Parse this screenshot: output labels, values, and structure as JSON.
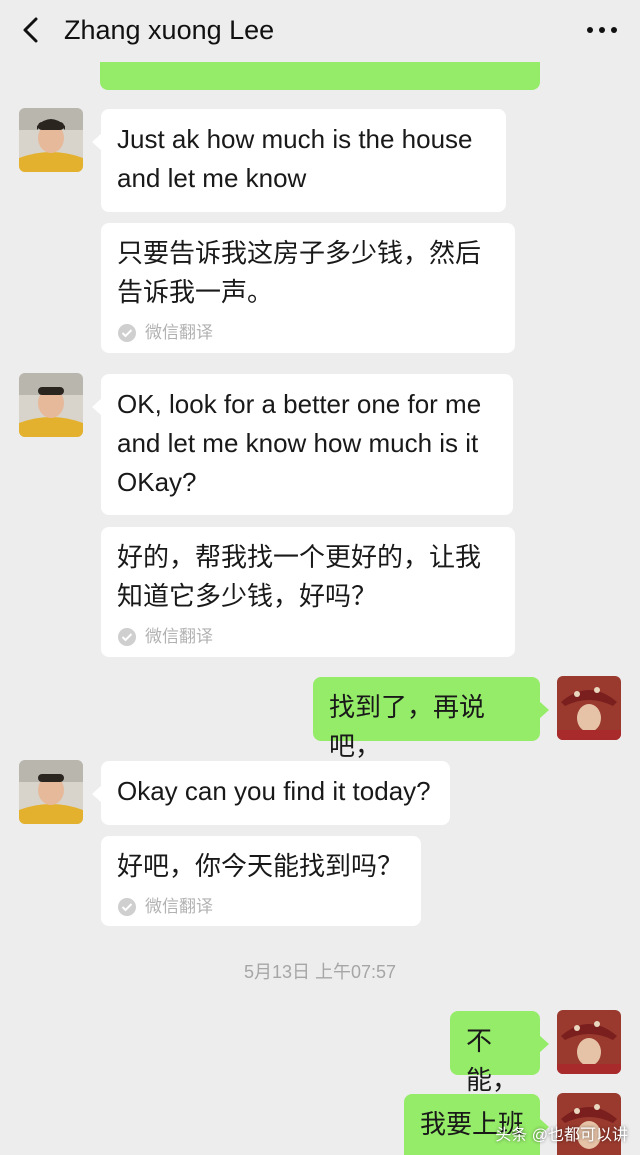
{
  "header": {
    "title": "Zhang  xuong Lee",
    "back_icon": "chevron-left-icon",
    "more_icon": "more-dots-icon"
  },
  "messages": [
    {
      "from": "other",
      "text": "Just ak how much is the house and let me know"
    },
    {
      "from": "other",
      "translation": "只要告诉我这房子多少钱，然后告诉我一声。",
      "translation_label": "微信翻译"
    },
    {
      "from": "other",
      "text": "OK, look for a better one for me and let me know how much is it OKay?"
    },
    {
      "from": "other",
      "translation": "好的，帮我找一个更好的，让我知道它多少钱，好吗？",
      "translation_label": "微信翻译"
    },
    {
      "from": "me",
      "text": "找到了，再说吧，"
    },
    {
      "from": "other",
      "text": "Okay can you find it today?"
    },
    {
      "from": "other",
      "translation": "好吧，你今天能找到吗？",
      "translation_label": "微信翻译"
    },
    {
      "from": "me",
      "text": "不能，"
    },
    {
      "from": "me",
      "text": "我要上班"
    }
  ],
  "timestamp": "5月13日 上午07:57",
  "watermark": "头条 @也都可以讲",
  "colors": {
    "background": "#ededed",
    "my_bubble": "#95ec69",
    "their_bubble": "#ffffff"
  }
}
